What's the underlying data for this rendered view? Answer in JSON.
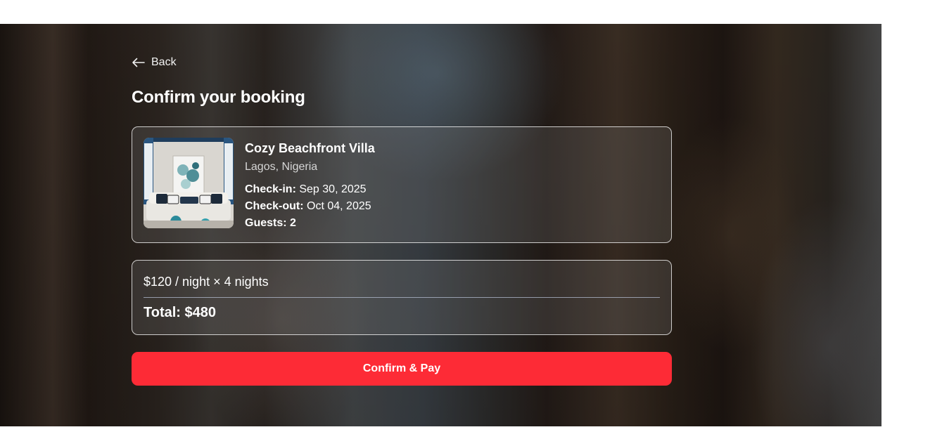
{
  "nav": {
    "back_label": "Back",
    "back_icon": "arrow-left-icon"
  },
  "page": {
    "title": "Confirm your booking"
  },
  "property": {
    "name": "Cozy Beachfront Villa",
    "location": "Lagos, Nigeria",
    "checkin_label": "Check-in:",
    "checkin_value": "Sep 30, 2025",
    "checkout_label": "Check-out:",
    "checkout_value": "Oct 04, 2025",
    "guests_label": "Guests:",
    "guests_value": "2",
    "image_alt": "living room with white sofa and abstract painting"
  },
  "pricing": {
    "rate_line": "$120 / night × 4 nights",
    "total_line": "Total: $480"
  },
  "actions": {
    "confirm_label": "Confirm & Pay"
  },
  "colors": {
    "accent": "#fd2b36",
    "text": "#ffffff"
  }
}
